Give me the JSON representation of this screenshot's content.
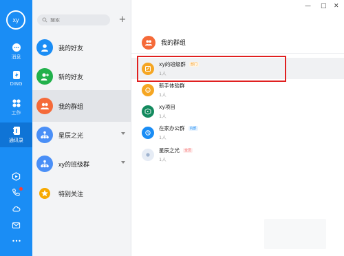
{
  "user": {
    "avatar_text": "xy"
  },
  "rail": {
    "items": [
      {
        "label": "消息",
        "icon": "message-icon"
      },
      {
        "label": "DING",
        "icon": "ding-icon"
      },
      {
        "label": "工作",
        "icon": "work-grid-icon"
      },
      {
        "label": "通讯录",
        "icon": "contacts-icon",
        "active": true
      }
    ],
    "bottom_icons": [
      "hexagon-icon",
      "phone-icon",
      "cloud-icon",
      "mail-icon",
      "more-dots-icon"
    ]
  },
  "search": {
    "placeholder": "搜索"
  },
  "add_button": "+",
  "contacts_menu": [
    {
      "label": "我的好友",
      "icon": "person-icon",
      "color": "#1a8df5"
    },
    {
      "label": "新的好友",
      "icon": "person-add-icon",
      "color": "#22b14c"
    },
    {
      "label": "我的群组",
      "icon": "group-icon",
      "color": "#f56a39",
      "selected": true
    },
    {
      "label": "星辰之光",
      "icon": "org-icon",
      "color": "#4a8ff7",
      "expandable": true
    },
    {
      "label": "xy的班级群",
      "icon": "org-icon",
      "color": "#4a8ff7",
      "expandable": true
    },
    {
      "label": "特别关注",
      "icon": "star-icon",
      "color": "#f7a900"
    }
  ],
  "window_controls": {
    "minimize": "—",
    "maximize": "□",
    "close": "✕"
  },
  "groups_panel": {
    "title": "我的群组",
    "groups": [
      {
        "name": "xy的班级群",
        "count": "1人",
        "tag": "部门",
        "tag_color": "orange",
        "icon_color": "#f5a623",
        "highlighted": true
      },
      {
        "name": "新手体验群",
        "count": "1人",
        "tag": "",
        "icon_color": "#f5a623"
      },
      {
        "name": "xy项目",
        "count": "1人",
        "tag": "",
        "icon_color": "#138a5e"
      },
      {
        "name": "在家办公群",
        "count": "1人",
        "tag": "内部",
        "tag_color": "blue",
        "icon_color": "#1a8df5"
      },
      {
        "name": "星辰之光",
        "count": "1人",
        "tag": "全员",
        "tag_color": "red",
        "icon_color": "#e6ecf5"
      }
    ]
  }
}
